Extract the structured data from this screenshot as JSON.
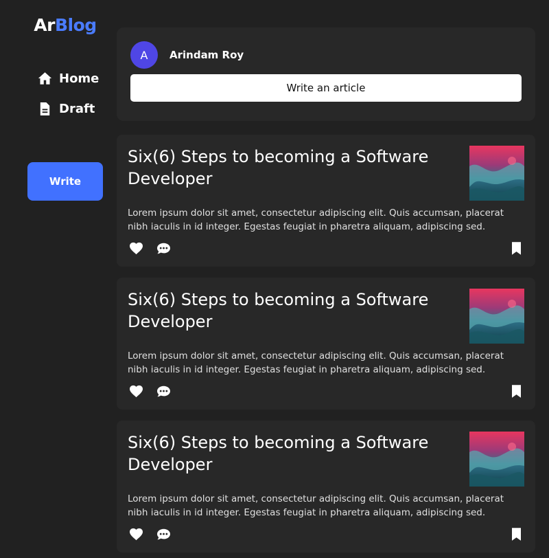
{
  "brand": {
    "part1": "Ar",
    "part2": "Blog",
    "accent": "#4a7cff"
  },
  "nav": [
    {
      "label": "Home",
      "icon": "home-icon"
    },
    {
      "label": "Draft",
      "icon": "document-icon"
    }
  ],
  "sidebar": {
    "write_label": "Write",
    "write_color": "#4171ff"
  },
  "composer": {
    "avatar_initial": "A",
    "avatar_color": "#4f46e5",
    "author_name": "Arindam Roy",
    "write_article_label": "Write an article"
  },
  "posts": [
    {
      "title": "Six(6) Steps to becoming a Software Developer",
      "excerpt": "Lorem ipsum dolor sit amet, consectetur adipiscing elit. Quis accumsan, placerat nibh iaculis in id integer. Egestas feugiat in pharetra aliquam, adipiscing sed.",
      "thumbnail": "abstract-ink-image"
    },
    {
      "title": "Six(6) Steps to becoming a Software Developer",
      "excerpt": "Lorem ipsum dolor sit amet, consectetur adipiscing elit. Quis accumsan, placerat nibh iaculis in id integer. Egestas feugiat in pharetra aliquam, adipiscing sed.",
      "thumbnail": "abstract-ink-image"
    },
    {
      "title": "Six(6) Steps to becoming a Software Developer",
      "excerpt": "Lorem ipsum dolor sit amet, consectetur adipiscing elit. Quis accumsan, placerat nibh iaculis in id integer. Egestas feugiat in pharetra aliquam, adipiscing sed.",
      "thumbnail": "abstract-ink-image"
    }
  ]
}
